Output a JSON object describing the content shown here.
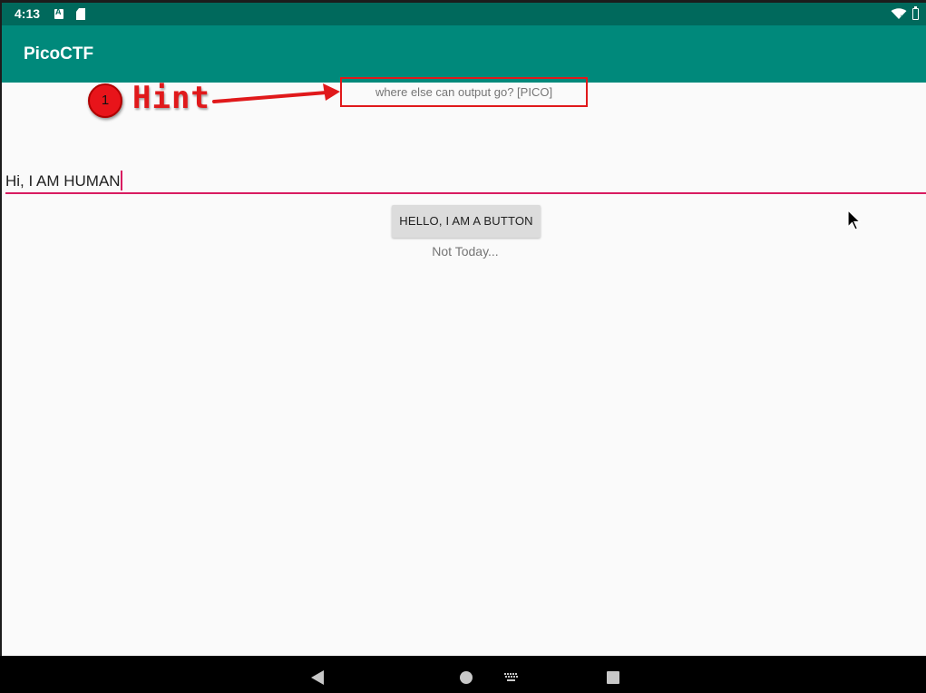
{
  "status_bar": {
    "time": "4:13",
    "icons": [
      "a-notification-icon",
      "sd-card-icon",
      "wifi-icon",
      "battery-icon"
    ]
  },
  "app_bar": {
    "title": "PicoCTF"
  },
  "annotation": {
    "number": "1",
    "label": "Hint",
    "color": "#e0191b"
  },
  "hint": {
    "text": "where else can output go? [PICO]"
  },
  "input": {
    "value": "Hi, I AM HUMAN",
    "underline_color": "#d81b60"
  },
  "button": {
    "label": "HELLO, I AM A BUTTON"
  },
  "result": {
    "text": "Not Today..."
  },
  "nav_bar": {
    "icons": [
      "back-icon",
      "home-icon",
      "keyboard-icon",
      "recents-icon"
    ]
  },
  "colors": {
    "primary": "#00897b",
    "primary_dark": "#00695c",
    "accent": "#d81b60"
  }
}
